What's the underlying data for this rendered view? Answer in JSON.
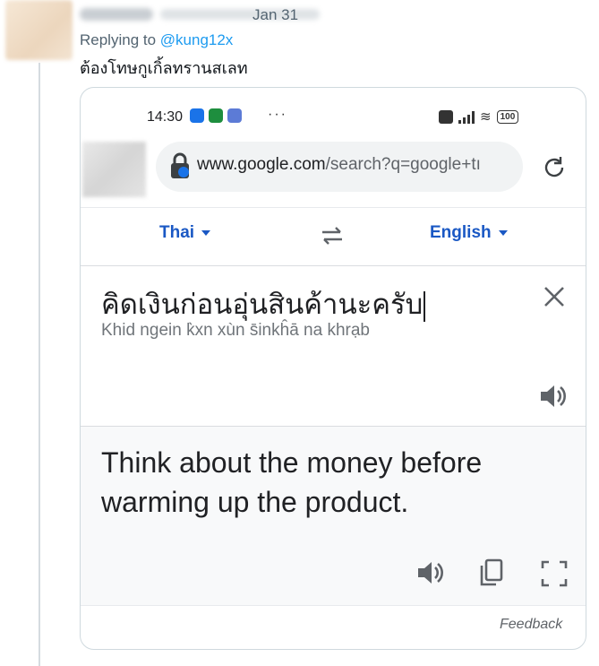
{
  "tweet": {
    "date": "Jan 31",
    "replying_prefix": "Replying to ",
    "replying_handle": "@kung12x",
    "text": "ต้องโทษกูเกิ้ลทรานสเลท"
  },
  "phone": {
    "status_time": "14:30",
    "status_more": "···",
    "battery": "100",
    "url_host": "www.google.com",
    "url_rest": "/search?q=google+tı"
  },
  "translate": {
    "source_lang": "Thai",
    "target_lang": "English",
    "source_text": "คิดเงินก่อนอุ่นสินค้านะครับ",
    "transliteration": "Khid ngein k̀xn xùn s̄inkĥā na khrạb",
    "translation": "Think about the money before warming up the product.",
    "feedback_label": "Feedback"
  },
  "icons": [
    "lock-icon",
    "reload-icon",
    "swap-icon",
    "close-icon",
    "speaker-icon",
    "copy-icon",
    "fullscreen-icon"
  ],
  "colors": {
    "accent_link": "#1d9bf0",
    "lang_blue": "#1a58c4"
  }
}
